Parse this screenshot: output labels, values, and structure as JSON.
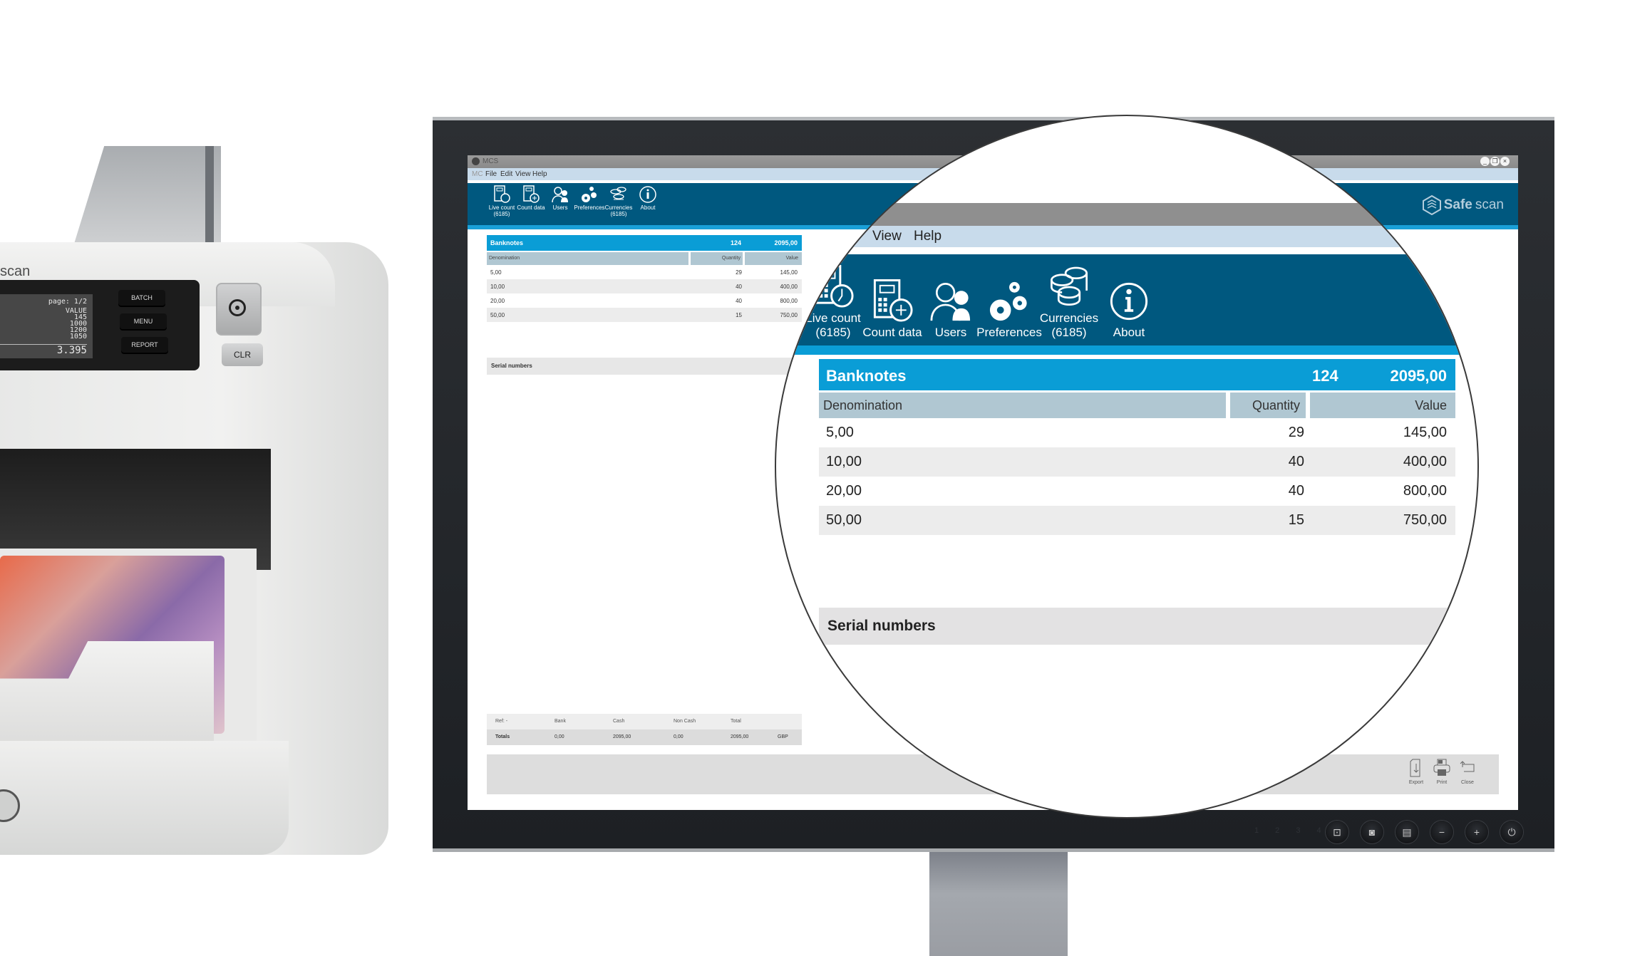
{
  "machine": {
    "brand": "scan",
    "lcd": {
      "page": "page: 1/2",
      "column_header": "VALUE",
      "values": [
        "145",
        "1000",
        "1200",
        "1050"
      ],
      "total": "3.395"
    },
    "buttons": [
      "BATCH",
      "MENU",
      "REPORT"
    ],
    "clear_button": "CLR"
  },
  "monitor": {
    "input_numbers": "1 2 3 4 5",
    "bezel_buttons": [
      "input-1-icon",
      "input-2-icon",
      "menu-icon",
      "minus-icon",
      "plus-icon",
      "power-icon"
    ],
    "bezel_glyphs": [
      "⊡",
      "◙",
      "▤",
      "−",
      "+",
      "⏻"
    ]
  },
  "app": {
    "window_title": "MCS",
    "window_controls": [
      "_",
      "❐",
      "×"
    ],
    "menu": [
      "MC",
      "File",
      "Edit",
      "View",
      "Help"
    ],
    "toolbar": [
      {
        "label": "Live count",
        "sub": "(6185)",
        "icon": "live-count-icon"
      },
      {
        "label": "Count data",
        "sub": "",
        "icon": "count-data-icon"
      },
      {
        "label": "Users",
        "sub": "",
        "icon": "users-icon"
      },
      {
        "label": "Preferences",
        "sub": "",
        "icon": "preferences-icon"
      },
      {
        "label": "Currencies",
        "sub": "(6185)",
        "icon": "currencies-icon"
      },
      {
        "label": "About",
        "sub": "",
        "icon": "about-icon"
      }
    ],
    "logo": {
      "bold": "Safe",
      "light": "scan"
    },
    "banknotes": {
      "title": "Banknotes",
      "total_quantity": "124",
      "total_value": "2095,00",
      "columns": [
        "Denomination",
        "Quantity",
        "Value"
      ],
      "rows": [
        {
          "denomination": "5,00",
          "quantity": "29",
          "value": "145,00"
        },
        {
          "denomination": "10,00",
          "quantity": "40",
          "value": "400,00"
        },
        {
          "denomination": "20,00",
          "quantity": "40",
          "value": "800,00"
        },
        {
          "denomination": "50,00",
          "quantity": "15",
          "value": "750,00"
        }
      ]
    },
    "serial_numbers_label": "Serial numbers",
    "totals": {
      "headers": [
        "Ref: -",
        "Bank",
        "Cash",
        "Non Cash",
        "Total",
        ""
      ],
      "row": [
        "Totals",
        "0,00",
        "2095,00",
        "0,00",
        "2095,00",
        "GBP"
      ]
    },
    "footer_buttons": [
      {
        "label": "Export",
        "icon": "export-icon"
      },
      {
        "label": "Print",
        "icon": "print-icon"
      },
      {
        "label": "Close",
        "icon": "close-icon"
      }
    ]
  },
  "colors": {
    "toolbar_blue": "#00587f",
    "accent_blue": "#0a9dd6",
    "column_header_grey_blue": "#b0c7d2",
    "menu_bar": "#c8dbeb"
  }
}
